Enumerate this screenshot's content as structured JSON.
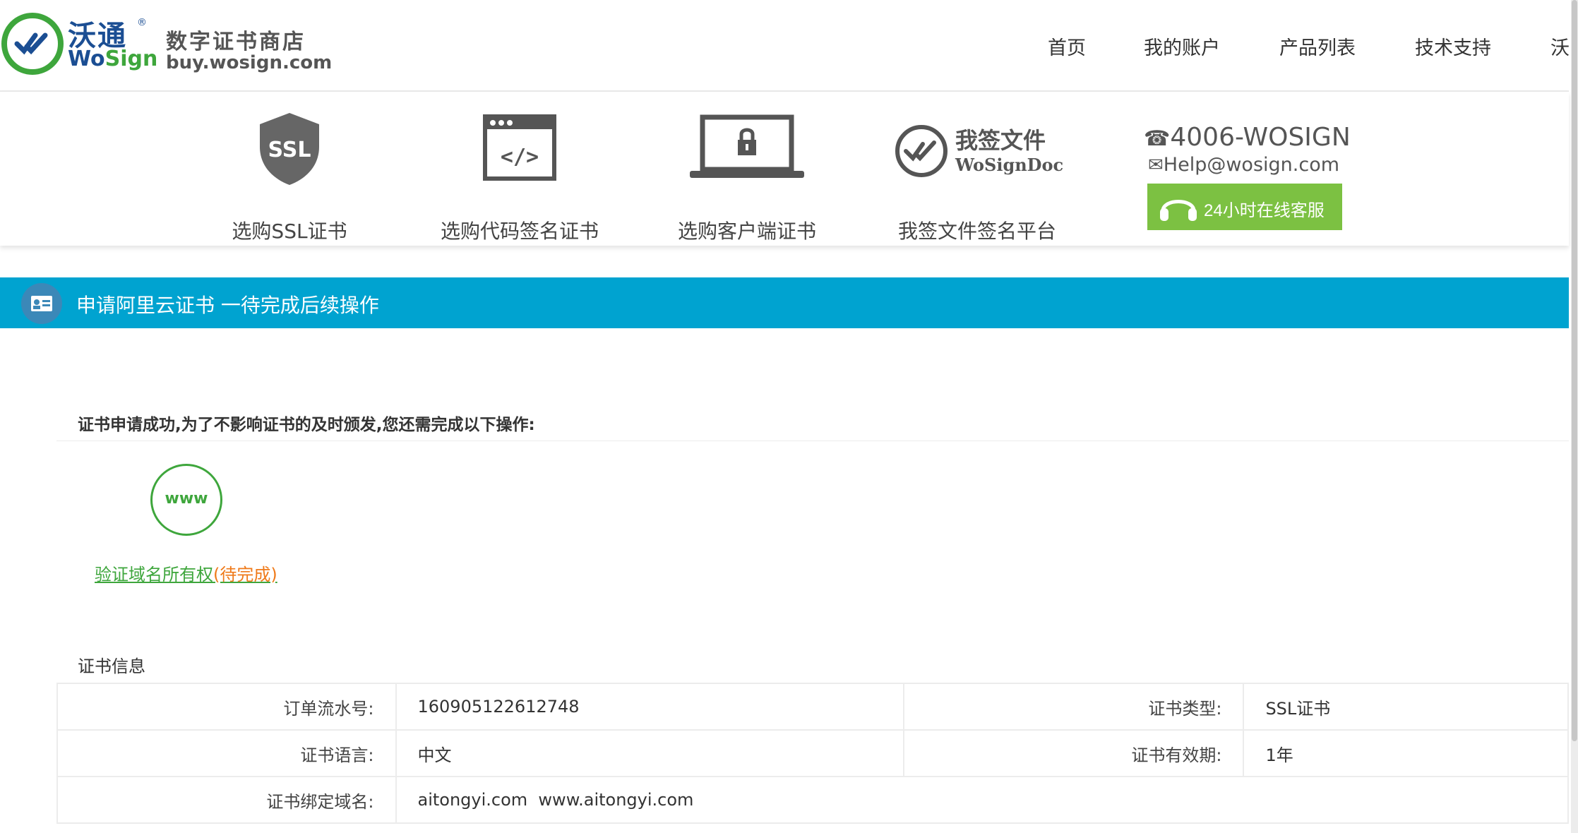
{
  "brand": {
    "name_cn": "沃通",
    "name_en_a": "Wo",
    "name_en_b": "Sign",
    "reg_mark": "®",
    "store_title": "数字证书商店",
    "store_url": "buy.wosign.com",
    "colors": {
      "blue": "#1b4e93",
      "green": "#3ea63c"
    }
  },
  "nav": {
    "items": [
      "首页",
      "我的账户",
      "产品列表",
      "技术支持",
      "沃"
    ]
  },
  "products": [
    {
      "label": "选购SSL证书",
      "icon": "ssl-shield-icon",
      "icon_text": "SSL"
    },
    {
      "label": "选购代码签名证书",
      "icon": "code-window-icon",
      "icon_text": "</>"
    },
    {
      "label": "选购客户端证书",
      "icon": "laptop-lock-icon"
    },
    {
      "label": "我签文件签名平台",
      "icon": "wosigndoc-logo-icon",
      "logo_cn": "我签文件",
      "logo_en": "WoSignDoc"
    }
  ],
  "contact": {
    "phone": "4006-WOSIGN",
    "email": "Help@wosign.com",
    "service_label": "24小时在线客服",
    "service_color": "#7cc142"
  },
  "titlebar": {
    "title": "申请阿里云证书 一待完成后续操作",
    "color": "#00a3d0"
  },
  "notice": "证书申请成功,为了不影响证书的及时颁发,您还需完成以下操作:",
  "step": {
    "icon_text": "www",
    "link_label": "验证域名所有权",
    "status": "(待完成)"
  },
  "cert_info": {
    "title": "证书信息",
    "rows": [
      {
        "l1": "订单流水号:",
        "v1": "160905122612748",
        "l2": "证书类型:",
        "v2": "SSL证书"
      },
      {
        "l1": "证书语言:",
        "v1": "中文",
        "l2": "证书有效期:",
        "v2": "1年"
      },
      {
        "l1": "证书绑定域名:",
        "v1": "aitongyi.com  www.aitongyi.com"
      }
    ]
  }
}
